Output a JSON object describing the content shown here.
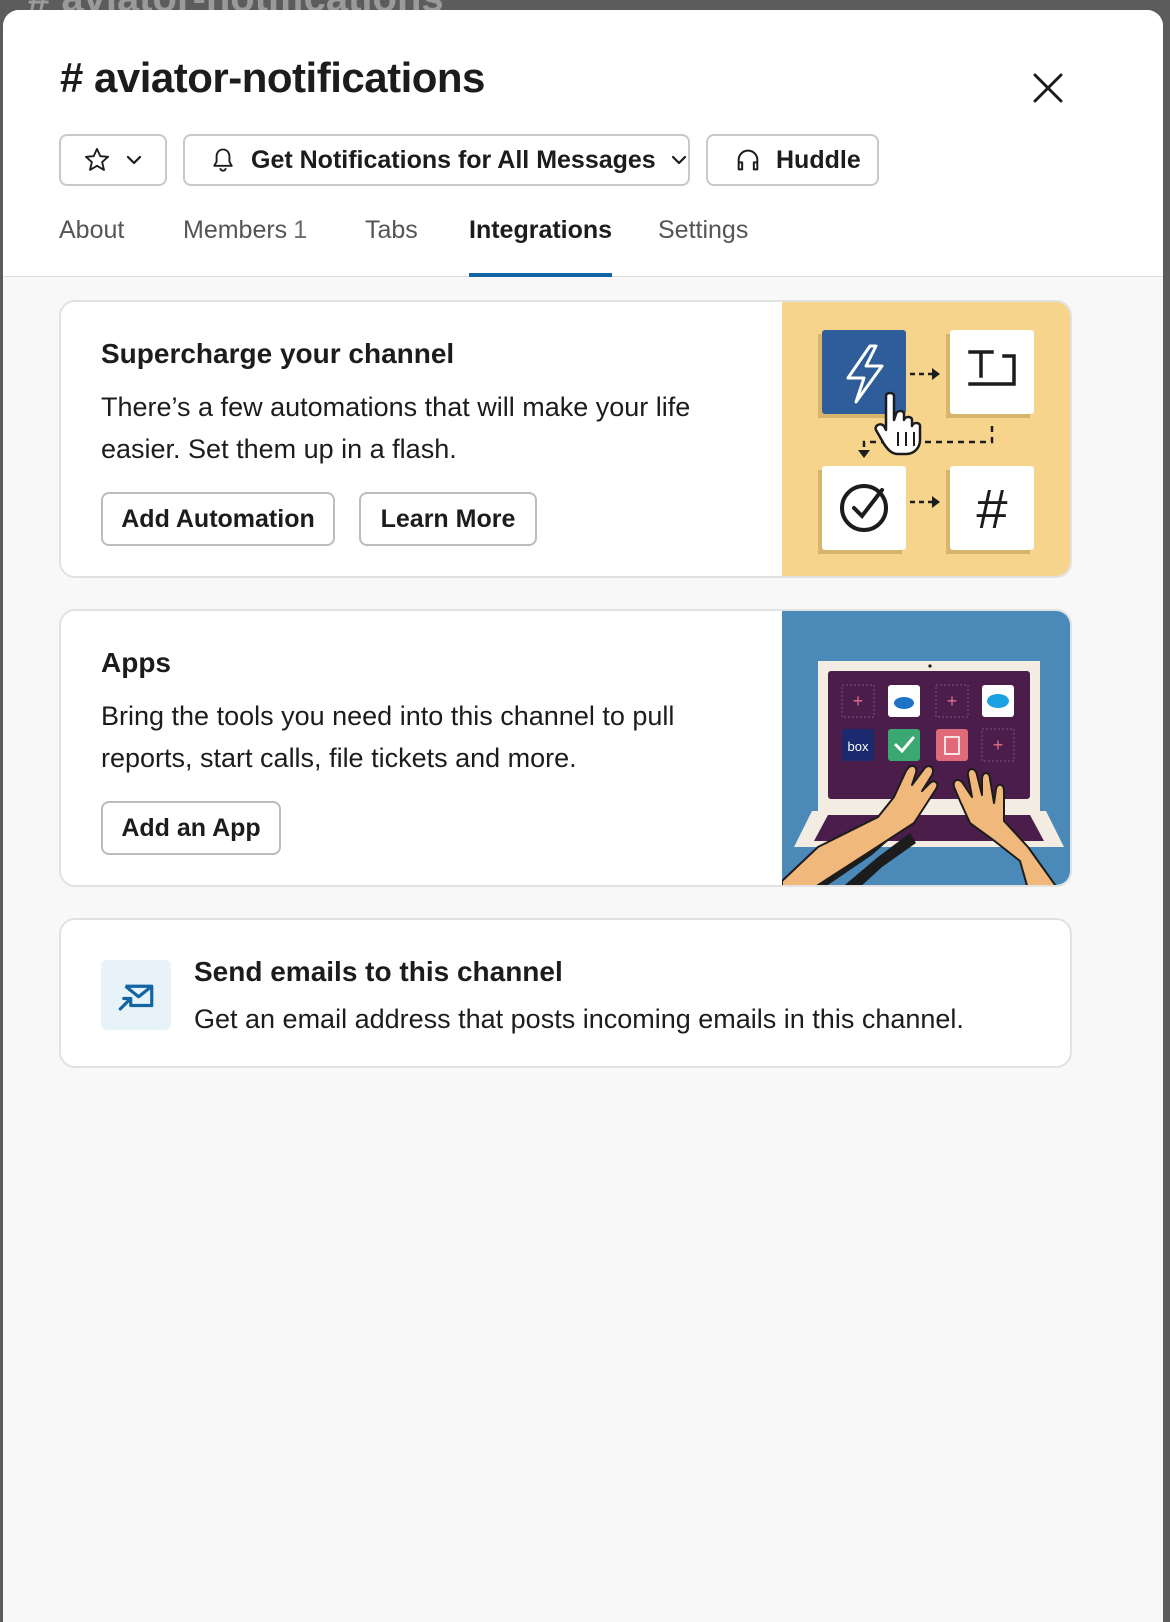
{
  "background_title": "# aviator-notifications",
  "modal": {
    "title": "# aviator-notifications",
    "close_label": "×"
  },
  "toolbar": {
    "notifications_label": "Get Notifications for All Messages",
    "huddle_label": "Huddle"
  },
  "tabs": [
    {
      "label": "About",
      "count": ""
    },
    {
      "label": "Members",
      "count": "1"
    },
    {
      "label": "Tabs",
      "count": ""
    },
    {
      "label": "Integrations",
      "count": "",
      "active": true
    },
    {
      "label": "Settings",
      "count": ""
    }
  ],
  "automation_card": {
    "title": "Supercharge your channel",
    "description": "There’s a few automations that will make your life easier. Set them up in a flash.",
    "add_button": "Add Automation",
    "learn_button": "Learn More"
  },
  "apps_card": {
    "title": "Apps",
    "description": "Bring the tools you need into this channel to pull reports, start calls, file tickets and more.",
    "add_button": "Add an App",
    "illustration_labels": {
      "box": "box"
    }
  },
  "email_card": {
    "title": "Send emails to this channel",
    "description": "Get an email address that posts incoming emails in this channel."
  },
  "colors": {
    "accent": "#1264a3",
    "automation_illustration_bg": "#f7d48c",
    "apps_illustration_bg": "#4a89b8",
    "laptop_screen": "#4a1d4a"
  }
}
